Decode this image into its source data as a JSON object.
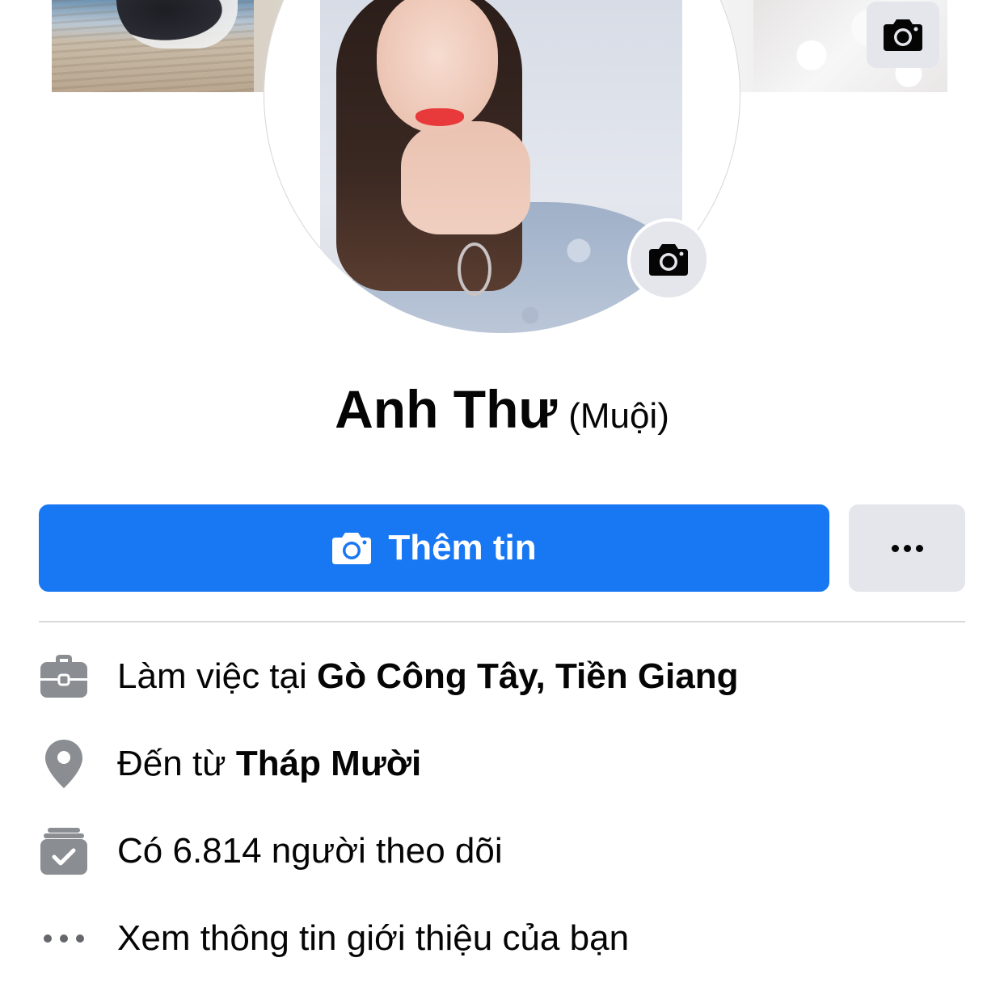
{
  "cover": {
    "camera_icon": "camera-icon"
  },
  "profile": {
    "name": "Anh Thư",
    "alternate_name": "(Muội)",
    "avatar_camera_icon": "camera-icon"
  },
  "actions": {
    "add_story_label": "Thêm tin",
    "add_story_icon": "camera-icon",
    "more_icon": "more-dots-icon",
    "primary_color": "#1877f2",
    "secondary_bg": "#e4e6eb"
  },
  "intro": {
    "work": {
      "icon": "briefcase-icon",
      "prefix": "Làm việc tại ",
      "place": "Gò Công Tây, Tiền Giang"
    },
    "hometown": {
      "icon": "location-pin-icon",
      "prefix": "Đến từ ",
      "place": "Tháp Mười"
    },
    "followers": {
      "icon": "followers-check-icon",
      "text": "Có 6.814 người theo dõi"
    },
    "see_about": {
      "icon": "more-dots-icon",
      "text": "Xem thông tin giới thiệu của bạn"
    }
  }
}
